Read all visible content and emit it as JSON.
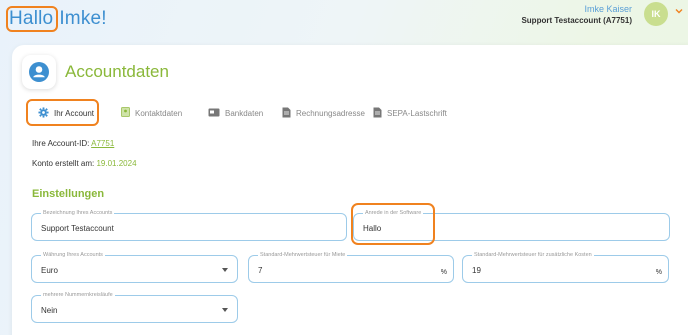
{
  "header": {
    "greeting_highlight": "Hallo",
    "greeting_name": "Imke!",
    "user_name": "Imke Kaiser",
    "user_account": "Support Testaccount (A7751)",
    "avatar_initials": "IK"
  },
  "card": {
    "title": "Accountdaten",
    "tabs": [
      {
        "label": "Ihr Account",
        "icon": "gear-icon"
      },
      {
        "label": "Kontaktdaten",
        "icon": "contact-card-icon"
      },
      {
        "label": "Bankdaten",
        "icon": "bank-card-icon"
      },
      {
        "label": "Rechnungsadresse",
        "icon": "document-icon"
      },
      {
        "label": "SEPA-Lastschrift",
        "icon": "document-icon"
      }
    ],
    "account_id_label": "Ihre Account-ID:",
    "account_id_value": "A7751",
    "created_label": "Konto erstellt am:",
    "created_value": "19.01.2024",
    "settings_title": "Einstellungen",
    "fields": {
      "account_name": {
        "legend": "Bezeichnung Ihres Accounts",
        "value": "Support Testaccount"
      },
      "salutation": {
        "legend": "Anrede in der Software",
        "value": "Hallo"
      },
      "currency": {
        "legend": "Währung Ihres Accounts",
        "value": "Euro"
      },
      "vat_rent": {
        "legend": "Standard-Mehrwertsteuer für Miete",
        "value": "7",
        "suffix": "%"
      },
      "vat_extra": {
        "legend": "Standard-Mehrwertsteuer für zusätzliche Kosten",
        "value": "19",
        "suffix": "%"
      },
      "number_ranges": {
        "legend": "mehrere Nummernkreisläufe",
        "value": "Nein"
      }
    }
  },
  "colors": {
    "accent_green": "#8ab83a",
    "accent_blue": "#3d8fd0",
    "highlight_orange": "#f0821f"
  }
}
